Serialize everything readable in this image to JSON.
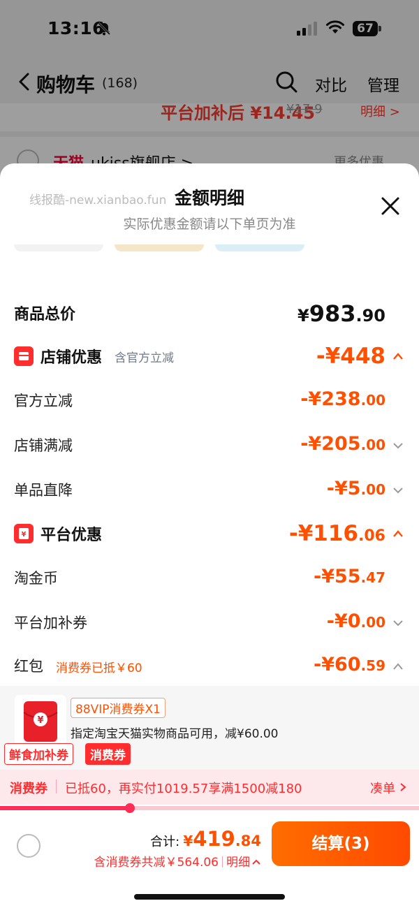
{
  "status_bar": {
    "time": "13:16",
    "battery": "67"
  },
  "nav": {
    "title": "购物车",
    "count": "(168)",
    "compare": "对比",
    "manage": "管理"
  },
  "background": {
    "promo_text": "平台加补后 ¥14.45",
    "promo_strike": "¥17.9",
    "promo_detail": "明细 >",
    "store_brand": "天猫",
    "store_name": "ukiss旗舰店 >",
    "store_more": "更多优惠"
  },
  "sheet": {
    "watermark": "线报酷-new.xianbao.fun",
    "title": "金额明细",
    "subtitle": "实际优惠金额请以下单页为准"
  },
  "rows": {
    "total": {
      "label": "商品总价",
      "currency": "¥",
      "int": "983",
      "dec": ".90"
    },
    "store_discount": {
      "label": "店铺优惠",
      "note": "含官方立减",
      "int": "-¥448",
      "dec": ""
    },
    "official": {
      "label": "官方立减",
      "int": "-¥238",
      "dec": ".00"
    },
    "store_full": {
      "label": "店铺满减",
      "int": "-¥205",
      "dec": ".00"
    },
    "single_drop": {
      "label": "单品直降",
      "int": "-¥5",
      "dec": ".00"
    },
    "platform_discount": {
      "label": "平台优惠",
      "int": "-¥116",
      "dec": ".06"
    },
    "taojinbi": {
      "label": "淘金币",
      "int": "-¥55",
      "dec": ".47"
    },
    "platform_coupon": {
      "label": "平台加补券",
      "int": "-¥0",
      "dec": ".00"
    },
    "red_packet": {
      "label": "红包",
      "note": "消费券已抵￥60",
      "int": "-¥60",
      "dec": ".59"
    }
  },
  "coupon": {
    "badge": "88VIP消费券X1",
    "desc": "指定淘宝天猫实物商品可用，减¥60.00",
    "tag_fresh": "鲜食加补券",
    "tag_consume": "消费券"
  },
  "consume_strip": {
    "label": "消费券",
    "text": "已抵60，再实付1019.57享满1500减180",
    "action": "凑单",
    "progress": 0.31
  },
  "bottom": {
    "sum_label": "合计:",
    "sum_currency": "¥",
    "sum_int": "419",
    "sum_dec": ".84",
    "saving": "含消费券共减￥564.06",
    "detail": "明细",
    "checkout": "结算(3)"
  },
  "colors": {
    "accent": "#ff5000",
    "red": "#ff2d2d",
    "pink": "#fde8ec"
  }
}
